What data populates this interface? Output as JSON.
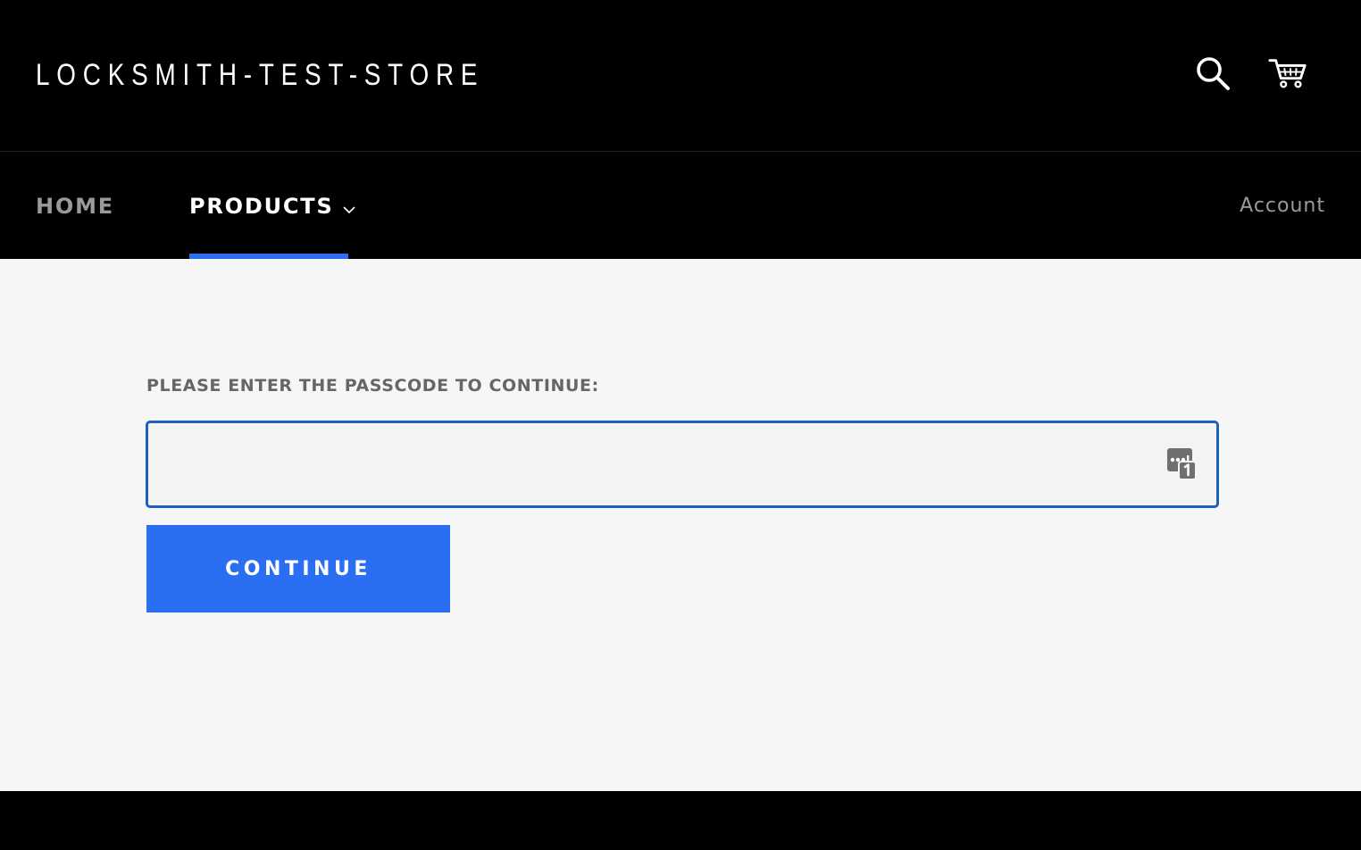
{
  "header": {
    "store_name": "LOCKSMITH-TEST-STORE",
    "icons": [
      "search-icon",
      "cart-icon"
    ]
  },
  "nav": {
    "items": [
      {
        "label": "HOME",
        "active": false
      },
      {
        "label": "PRODUCTS",
        "active": true,
        "has_dropdown": true
      }
    ],
    "account_label": "Account",
    "accent_color": "#2a6ff2"
  },
  "passcode": {
    "prompt": "PLEASE ENTER THE PASSCODE TO CONTINUE:",
    "value": "",
    "field_icon": "password-manager-icon",
    "field_border_color": "#1f5fc4",
    "button_label": "CONTINUE",
    "button_color": "#2a6ff2"
  }
}
